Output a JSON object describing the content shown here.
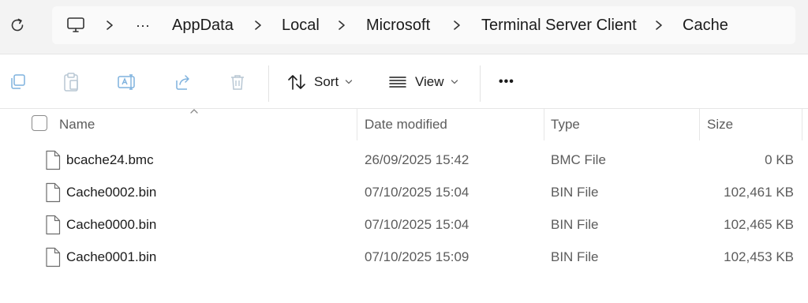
{
  "breadcrumb": {
    "overflow": "···",
    "items": [
      "AppData",
      "Local",
      "Microsoft",
      "Terminal Server Client",
      "Cache"
    ]
  },
  "toolbar": {
    "sort_label": "Sort",
    "view_label": "View",
    "more_label": "•••"
  },
  "columns": {
    "name": "Name",
    "date": "Date modified",
    "type": "Type",
    "size": "Size"
  },
  "files": [
    {
      "name": "bcache24.bmc",
      "date": "26/09/2025 15:42",
      "type": "BMC File",
      "size": "0 KB"
    },
    {
      "name": "Cache0002.bin",
      "date": "07/10/2025 15:04",
      "type": "BIN File",
      "size": "102,461 KB"
    },
    {
      "name": "Cache0000.bin",
      "date": "07/10/2025 15:04",
      "type": "BIN File",
      "size": "102,465 KB"
    },
    {
      "name": "Cache0001.bin",
      "date": "07/10/2025 15:09",
      "type": "BIN File",
      "size": "102,453 KB"
    }
  ],
  "colors": {
    "disabled_icon": "#7fb2de",
    "toolbar_icon": "#1b1b1b"
  }
}
